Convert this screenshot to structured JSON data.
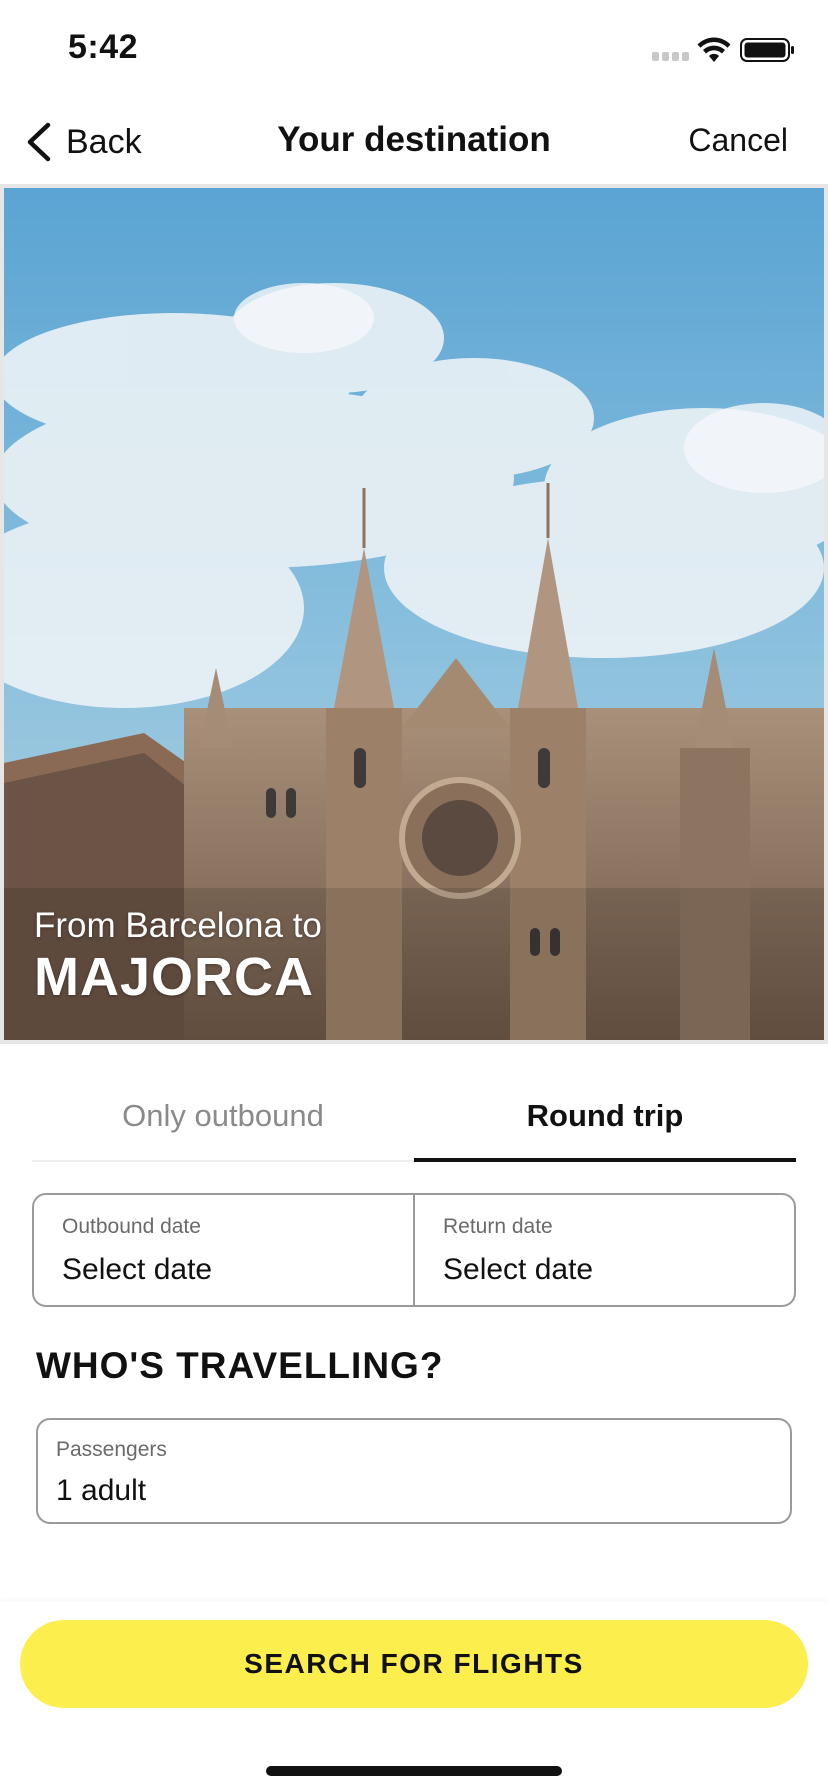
{
  "status_bar": {
    "time": "5:42"
  },
  "nav": {
    "back_label": "Back",
    "title": "Your destination",
    "cancel_label": "Cancel"
  },
  "hero": {
    "subtitle": "From Barcelona to",
    "destination": "MAJORCA"
  },
  "tabs": [
    {
      "label": "Only outbound",
      "active": false
    },
    {
      "label": "Round trip",
      "active": true
    }
  ],
  "dates": {
    "outbound": {
      "label": "Outbound date",
      "value": "Select date"
    },
    "return": {
      "label": "Return date",
      "value": "Select date"
    }
  },
  "travellers": {
    "heading": "WHO'S TRAVELLING?",
    "passengers_label": "Passengers",
    "passengers_value": "1 adult"
  },
  "cta": {
    "label": "SEARCH FOR FLIGHTS",
    "color": "#fbee4d"
  },
  "icons": {
    "back": "chevron-left-icon",
    "signal": "cellular-signal-icon",
    "wifi": "wifi-icon",
    "battery": "battery-icon"
  }
}
